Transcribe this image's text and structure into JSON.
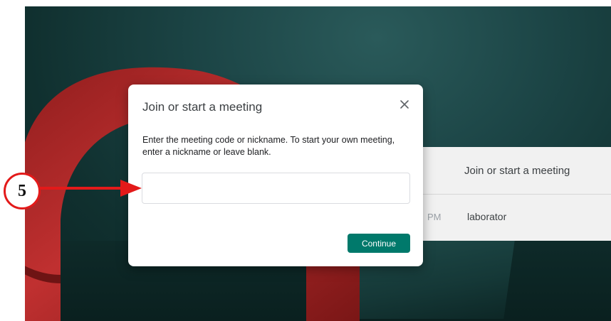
{
  "background": {
    "panel_title": "Join or start a meeting",
    "meeting_time": "PM",
    "meeting_name": "laborator"
  },
  "dialog": {
    "title": "Join or start a meeting",
    "description": "Enter the meeting code or nickname. To start your own meeting, enter a nickname or leave blank.",
    "input_value": "",
    "input_placeholder": "",
    "continue_label": "Continue",
    "close_icon": "close-icon"
  },
  "annotation": {
    "step_number": "5",
    "color": "#e31a1a"
  },
  "colors": {
    "accent": "#00796b",
    "backdrop": "#1c4546",
    "ring": "#b92a2a"
  }
}
